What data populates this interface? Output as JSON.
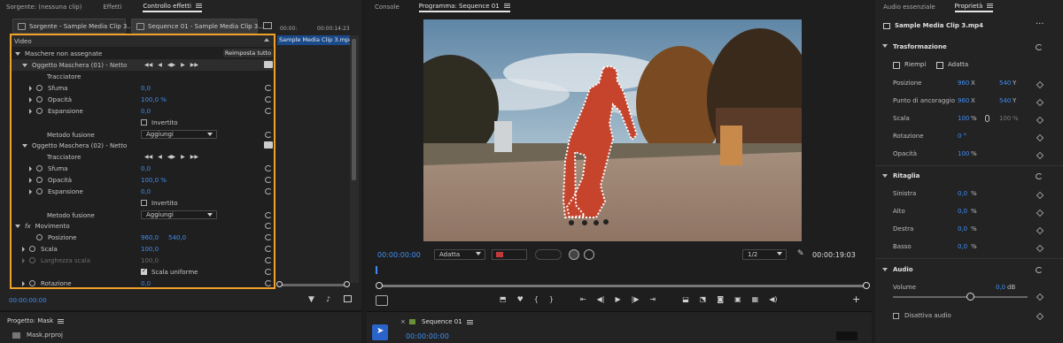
{
  "left_tabs": {
    "source": "Sorgente: (nessuna clip)",
    "effects": "Effetti",
    "effect_controls": "Controllo effetti"
  },
  "clip_tabs": {
    "source_clip": "Sorgente - Sample Media Clip 3...",
    "sequence_clip": "Sequence 01 - Sample Media Clip 3..."
  },
  "timeline_mini": {
    "timecode": "00:00:14:23",
    "clip_label": "Sample Media Clip 3.mp4",
    "start_tc": "00:00:"
  },
  "fx": {
    "video_header": "Video",
    "unassigned_masks": "Maschere non assegnate",
    "reset_all": "Reimposta tutto",
    "mask1": {
      "title": "Oggetto Maschera (01) - Netto",
      "tracker": "Tracciatore",
      "feather_label": "Sfuma",
      "feather_value": "0,0",
      "opacity_label": "Opacità",
      "opacity_value": "100,0 %",
      "expansion_label": "Espansione",
      "expansion_value": "0,0",
      "inverted_label": "Invertito",
      "blend_label": "Metodo fusione",
      "blend_value": "Aggiungi"
    },
    "mask2": {
      "title": "Oggetto Maschera (02) - Netto",
      "tracker": "Tracciatore",
      "feather_label": "Sfuma",
      "feather_value": "0,0",
      "opacity_label": "Opacità",
      "opacity_value": "100,0 %",
      "expansion_label": "Espansione",
      "expansion_value": "0,0",
      "inverted_label": "Invertito",
      "blend_label": "Metodo fusione",
      "blend_value": "Aggiungi"
    },
    "motion": {
      "fx_badge": "fx",
      "title": "Movimento",
      "position_label": "Posizione",
      "position_x": "960,0",
      "position_y": "540,0",
      "scale_label": "Scala",
      "scale_value": "100,0",
      "scale_width_label": "Larghezza scala",
      "scale_width_value": "100,0",
      "uniform_label": "Scala uniforme",
      "rotation_label": "Rotazione",
      "rotation_value": "0,0"
    },
    "bottom_tc": "00:00:00:00"
  },
  "program": {
    "console_tab": "Console",
    "program_tab": "Programma: Sequence 01",
    "timecode_in": "00:00:00:00",
    "fit": "Adatta",
    "resolution": "1/2",
    "timecode_out": "00:00:19:03"
  },
  "right_tabs": {
    "essential_audio": "Audio essenziale",
    "properties": "Proprietà"
  },
  "properties": {
    "clip_name": "Sample Media Clip 3.mp4",
    "transform_title": "Trasformazione",
    "fill_label": "Riempi",
    "fit_label": "Adatta",
    "position_label": "Posizione",
    "position_x": "960",
    "position_y": "540",
    "anchor_label": "Punto di ancoraggio",
    "anchor_x": "960",
    "anchor_y": "540",
    "scale_label": "Scala",
    "scale_value": "100",
    "scale_linked_value": "100",
    "rotation_label": "Rotazione",
    "rotation_value": "0 °",
    "opacity_label": "Opacità",
    "opacity_value": "100",
    "crop_title": "Ritaglia",
    "left_label": "Sinistra",
    "left_value": "0,0",
    "top_label": "Alto",
    "top_value": "0,0",
    "right_label": "Destra",
    "right_value": "0,0",
    "bottom_label": "Basso",
    "bottom_value": "0,0",
    "audio_title": "Audio",
    "volume_label": "Volume",
    "volume_value": "0,0",
    "volume_unit": "dB",
    "mute_label": "Disattiva audio",
    "x": "X",
    "y": "Y",
    "pct": "%"
  },
  "bottom": {
    "project_tab": "Progetto: Mask",
    "project_file": "Mask.prproj",
    "sequence_tab": "Sequence 01",
    "sequence_tc": "00:00:00:00"
  },
  "colors": {
    "accent_blue": "#3f8ef4",
    "highlight_orange": "#f0a12a"
  }
}
